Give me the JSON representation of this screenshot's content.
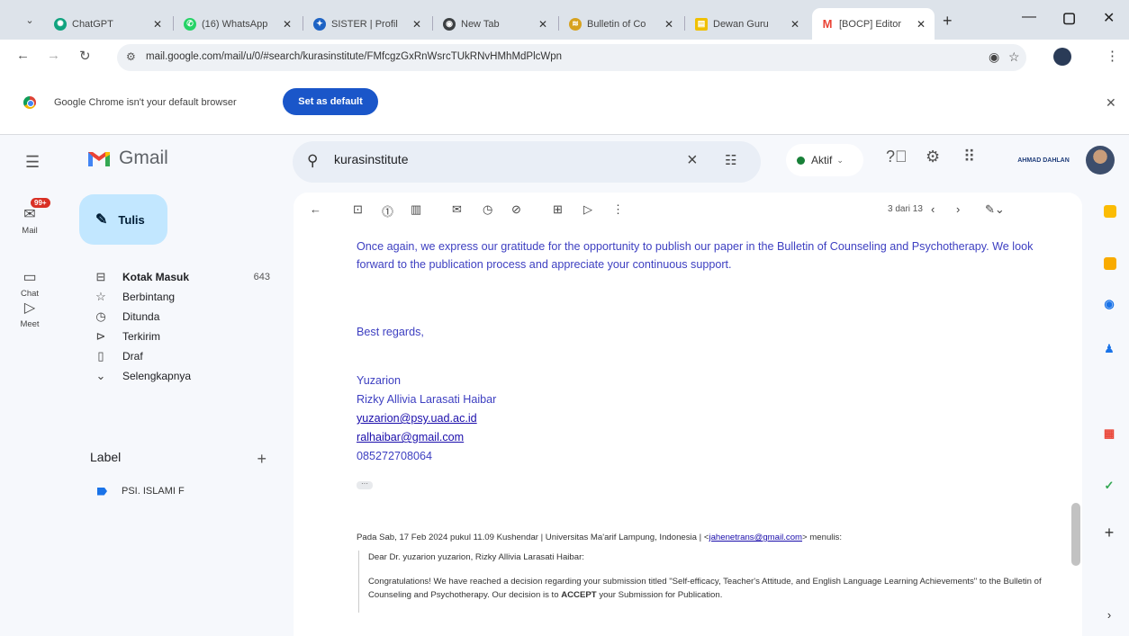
{
  "browser": {
    "tabs": [
      {
        "label": "ChatGPT",
        "color": "#10a37f"
      },
      {
        "label": "(16) WhatsApp",
        "color": "#25d366"
      },
      {
        "label": "SISTER | Profil",
        "color": "#1e63c4"
      },
      {
        "label": "New Tab",
        "color": "#3c4043"
      },
      {
        "label": "Bulletin of Co",
        "color": "#d7a21f"
      },
      {
        "label": "Dewan Guru",
        "color": "#f0c000"
      },
      {
        "label": "[BOCP] Editor",
        "color": "#ea4335"
      }
    ],
    "url": "mail.google.com/mail/u/0/#search/kurasinstitute/FMfcgzGxRnWsrcTUkRNvHMhMdPlcWpn",
    "infobar_text": "Google Chrome isn't your default browser",
    "infobar_button": "Set as default"
  },
  "gmail": {
    "brand": "Gmail",
    "search_value": "kurasinstitute",
    "status_label": "Aktif",
    "org_logo_text": "AHMAD DAHLAN",
    "rail": [
      {
        "label": "Mail",
        "badge": "99+"
      },
      {
        "label": "Chat"
      },
      {
        "label": "Meet"
      }
    ],
    "compose_label": "Tulis",
    "nav": [
      {
        "label": "Kotak Masuk",
        "count": "643",
        "bold": true
      },
      {
        "label": "Berbintang"
      },
      {
        "label": "Ditunda"
      },
      {
        "label": "Terkirim"
      },
      {
        "label": "Draf"
      },
      {
        "label": "Selengkapnya"
      }
    ],
    "labels_heading": "Label",
    "labels": [
      {
        "name": "PSI. ISLAMI F"
      }
    ],
    "pager": "3 dari 13"
  },
  "message": {
    "paragraph": "Once again, we express our gratitude for the opportunity to publish our paper in the Bulletin of Counseling and Psychotherapy. We look forward to the publication process and appreciate your continuous support.",
    "closing": "Best regards,",
    "names": [
      "Yuzarion",
      "Rizky Allivia Larasati Haibar"
    ],
    "emails": [
      "yuzarion@psy.uad.ac.id",
      "ralhaibar@gmail.com"
    ],
    "phone": "085272708064",
    "quote_header_prefix": "Pada Sab, 17 Feb 2024 pukul 11.09 Kushendar | Universitas Ma'arif Lampung, Indonesia | <",
    "quote_header_email": "jahenetrans@gmail.com",
    "quote_header_suffix": "> menulis:",
    "quote_greeting": "Dear Dr. yuzarion yuzarion, Rizky Allivia Larasati Haibar:",
    "quote_body_prefix": "Congratulations! We have reached a decision regarding your submission titled \"Self-efficacy, Teacher's Attitude, and English Language Learning Achievements\" to the Bulletin of Counseling and Psychotherapy. Our decision is to ",
    "quote_body_bold": "ACCEPT",
    "quote_body_suffix": " your Submission for Publication."
  }
}
